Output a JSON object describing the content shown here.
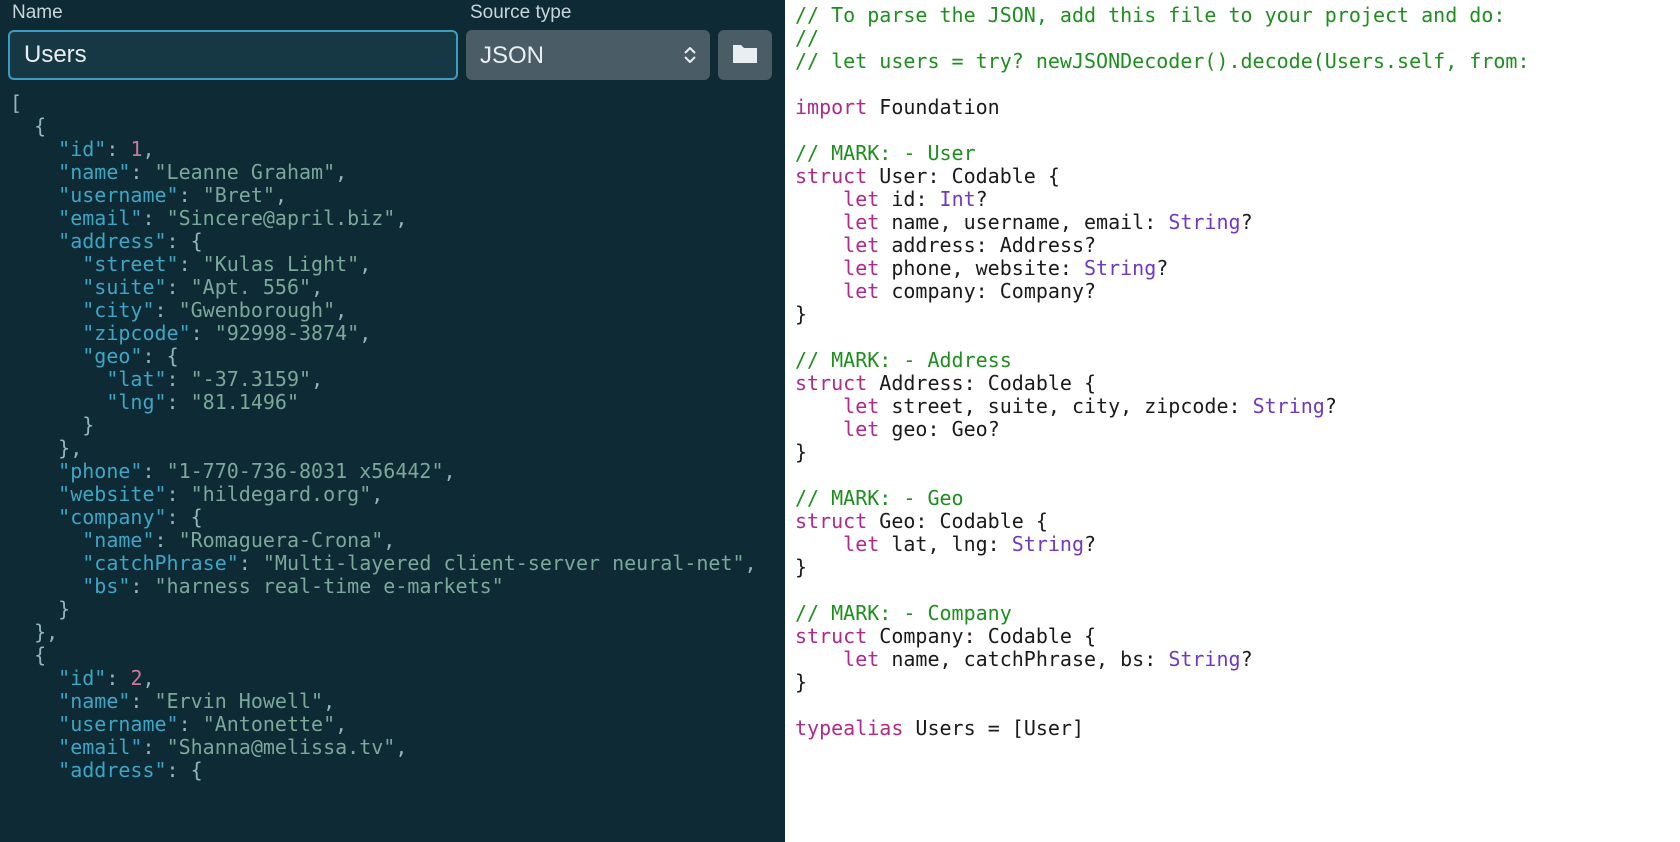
{
  "toolbar": {
    "name_label": "Name",
    "name_value": "Users",
    "source_label": "Source type",
    "source_value": "JSON"
  },
  "json_input": {
    "records": [
      {
        "id": 1,
        "name": "Leanne Graham",
        "username": "Bret",
        "email": "Sincere@april.biz",
        "address": {
          "street": "Kulas Light",
          "suite": "Apt. 556",
          "city": "Gwenborough",
          "zipcode": "92998-3874",
          "geo": {
            "lat": "-37.3159",
            "lng": "81.1496"
          }
        },
        "phone": "1-770-736-8031 x56442",
        "website": "hildegard.org",
        "company": {
          "name": "Romaguera-Crona",
          "catchPhrase": "Multi-layered client-server neural-net",
          "bs": "harness real-time e-markets"
        }
      },
      {
        "id": 2,
        "name": "Ervin Howell",
        "username": "Antonette",
        "email": "Shanna@melissa.tv",
        "address": {}
      }
    ]
  },
  "swift_output": {
    "lines": [
      {
        "t": "cm",
        "s": "// To parse the JSON, add this file to your project and do:"
      },
      {
        "t": "cm",
        "s": "//"
      },
      {
        "t": "cm",
        "s": "//    let users = try? newJSONDecoder().decode(Users.self, from: "
      },
      {
        "t": "blank",
        "s": ""
      },
      {
        "t": "import",
        "kw": "import",
        "id": "Foundation"
      },
      {
        "t": "blank",
        "s": ""
      },
      {
        "t": "cm",
        "s": "// MARK: - User"
      },
      {
        "t": "struct",
        "kw": "struct",
        "name": "User",
        "proto": "Codable"
      },
      {
        "t": "let1",
        "kw": "let",
        "names": "id",
        "ty": "Int",
        "opt": "?"
      },
      {
        "t": "let1",
        "kw": "let",
        "names": "name, username, email",
        "ty": "String",
        "opt": "?"
      },
      {
        "t": "let1",
        "kw": "let",
        "names": "address",
        "ty": "Address",
        "opt": "?",
        "tyColor": "id"
      },
      {
        "t": "let1",
        "kw": "let",
        "names": "phone, website",
        "ty": "String",
        "opt": "?"
      },
      {
        "t": "let1",
        "kw": "let",
        "names": "company",
        "ty": "Company",
        "opt": "?",
        "tyColor": "id"
      },
      {
        "t": "close",
        "s": "}"
      },
      {
        "t": "blank",
        "s": ""
      },
      {
        "t": "cm",
        "s": "// MARK: - Address"
      },
      {
        "t": "struct",
        "kw": "struct",
        "name": "Address",
        "proto": "Codable"
      },
      {
        "t": "let1",
        "kw": "let",
        "names": "street, suite, city, zipcode",
        "ty": "String",
        "opt": "?"
      },
      {
        "t": "let1",
        "kw": "let",
        "names": "geo",
        "ty": "Geo",
        "opt": "?",
        "tyColor": "id"
      },
      {
        "t": "close",
        "s": "}"
      },
      {
        "t": "blank",
        "s": ""
      },
      {
        "t": "cm",
        "s": "// MARK: - Geo"
      },
      {
        "t": "struct",
        "kw": "struct",
        "name": "Geo",
        "proto": "Codable"
      },
      {
        "t": "let1",
        "kw": "let",
        "names": "lat, lng",
        "ty": "String",
        "opt": "?"
      },
      {
        "t": "close",
        "s": "}"
      },
      {
        "t": "blank",
        "s": ""
      },
      {
        "t": "cm",
        "s": "// MARK: - Company"
      },
      {
        "t": "struct",
        "kw": "struct",
        "name": "Company",
        "proto": "Codable"
      },
      {
        "t": "let1",
        "kw": "let",
        "names": "name, catchPhrase, bs",
        "ty": "String",
        "opt": "?"
      },
      {
        "t": "close",
        "s": "}"
      },
      {
        "t": "blank",
        "s": ""
      },
      {
        "t": "typealias",
        "kw": "typealias",
        "name": "Users",
        "rhs": "[User]"
      }
    ]
  }
}
